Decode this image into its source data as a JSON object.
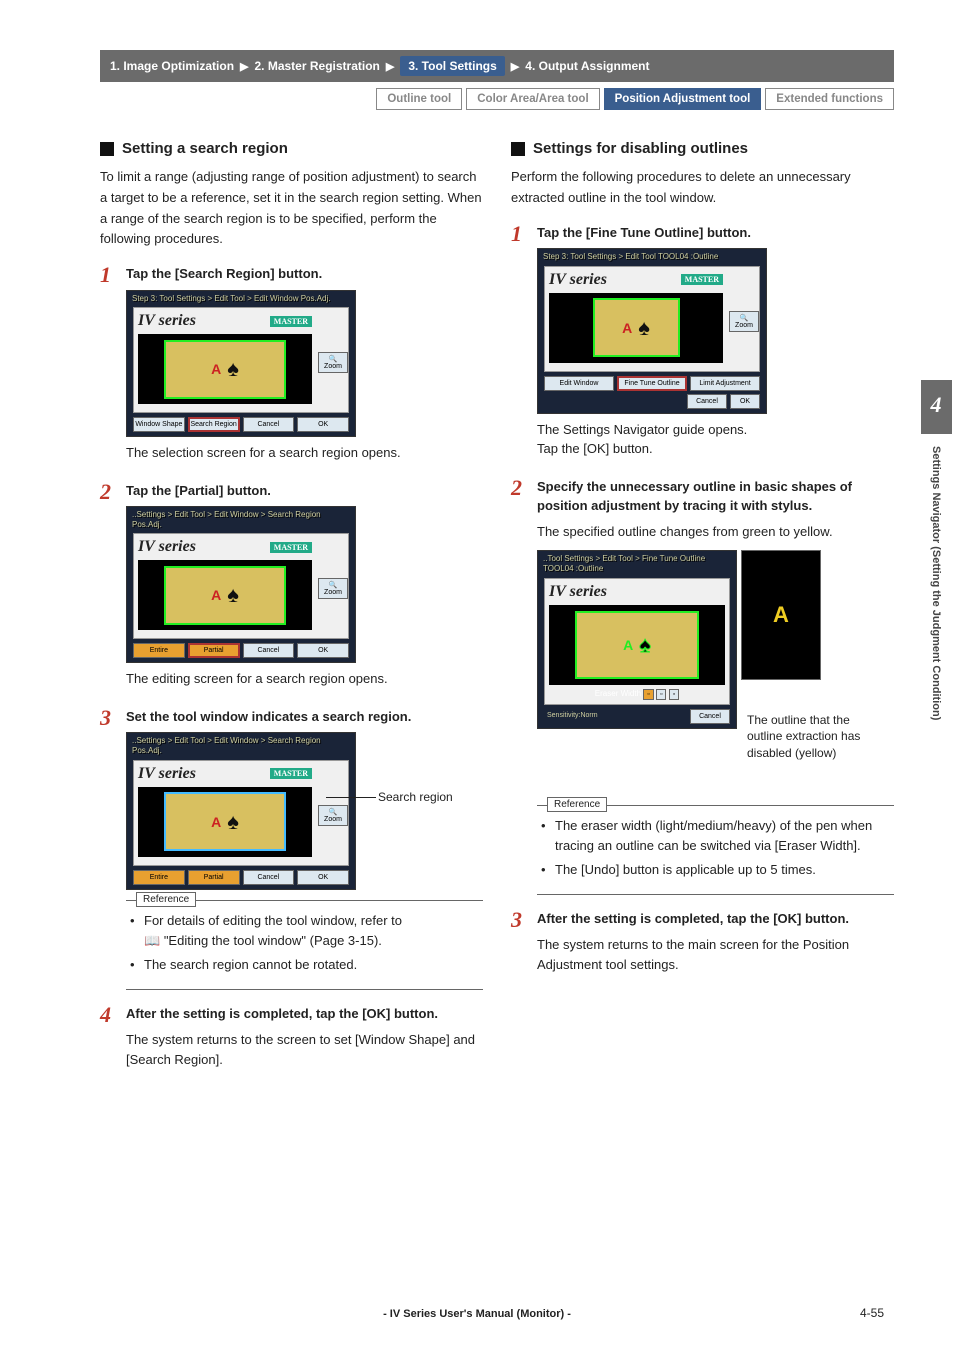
{
  "breadcrumb": {
    "items": [
      "1. Image Optimization",
      "2. Master Registration",
      "3. Tool Settings",
      "4. Output Assignment"
    ],
    "active_index": 2
  },
  "tabs": {
    "items": [
      "Outline tool",
      "Color Area/Area tool",
      "Position Adjustment tool",
      "Extended functions"
    ],
    "active_index": 2
  },
  "sidebar": {
    "chapter": "4",
    "title": "Settings Navigator (Setting the Judgment Condition)"
  },
  "left": {
    "heading": "Setting a search region",
    "intro": "To limit a range (adjusting range of position adjustment) to search a target to be a reference, set it in the search region setting. When a range of the search region is to be specified, perform the following procedures.",
    "steps": [
      {
        "num": "1",
        "title": "Tap the [Search Region] button.",
        "shot": {
          "crumbs": "Step 3: Tool Settings > Edit Tool > Edit Window Pos.Adj.",
          "buttons": [
            "Window Shape",
            "Search Region",
            "Cancel",
            "OK"
          ],
          "highlight": 1
        },
        "after": "The selection screen for a search region opens."
      },
      {
        "num": "2",
        "title": "Tap the [Partial] button.",
        "shot": {
          "crumbs": "..Settings > Edit Tool > Edit Window > Search Region Pos.Adj.",
          "buttons_orange": [
            "Entire",
            "Partial"
          ],
          "buttons": [
            "Cancel",
            "OK"
          ],
          "highlight_orange": 1
        },
        "after": "The editing screen for a search region opens."
      },
      {
        "num": "3",
        "title": "Set the tool window indicates a search region.",
        "shot": {
          "crumbs": "..Settings > Edit Tool > Edit Window > Search Region Pos.Adj.",
          "buttons_orange": [
            "Entire",
            "Partial"
          ],
          "buttons": [
            "Cancel",
            "OK"
          ]
        },
        "callout": "Search region",
        "reference": [
          "For details of editing the tool window, refer to",
          "\"Editing the tool window\" (Page 3-15).",
          "The search region cannot be rotated."
        ]
      },
      {
        "num": "4",
        "title": "After the setting is completed, tap the [OK] button.",
        "after": "The system returns to the screen to set [Window Shape] and [Search Region]."
      }
    ]
  },
  "right": {
    "heading": "Settings for disabling outlines",
    "intro": "Perform the following procedures to delete an unnecessary extracted outline in the tool window.",
    "steps": [
      {
        "num": "1",
        "title": "Tap the [Fine Tune Outline] button.",
        "shot": {
          "crumbs": "Step 3: Tool Settings > Edit Tool TOOL04 :Outline",
          "buttons": [
            "Edit Window",
            "Fine Tune Outline",
            "Limit Adjustment",
            "Cancel",
            "OK"
          ],
          "highlight": 1
        },
        "after": "The Settings Navigator guide opens.\nTap the [OK] button."
      },
      {
        "num": "2",
        "title": "Specify the unnecessary outline in basic shapes of position adjustment by tracing it with stylus.",
        "pre": "The specified outline changes from green to yellow.",
        "shot": {
          "crumbs": "..Tool Settings > Edit Tool > Fine Tune Outline TOOL04 :Outline",
          "bottom": "Eraser Width",
          "sens": "Sensitivity:Norm",
          "cancel": "Cancel"
        },
        "callout": "The outline that the outline extraction has disabled (yellow)",
        "reference": [
          "The eraser width (light/medium/heavy) of the pen when tracing an outline can be switched via [Eraser Width].",
          "The [Undo] button is applicable up to 5 times."
        ]
      },
      {
        "num": "3",
        "title": "After the setting is completed, tap the [OK] button.",
        "after": "The system returns to the main screen for the Position Adjustment tool settings."
      }
    ]
  },
  "ui": {
    "iv": "IV series",
    "master": "MASTER",
    "zoom": "🔍 Zoom",
    "reference_label": "Reference"
  },
  "footer": {
    "text": "- IV Series User's Manual (Monitor) -",
    "page": "4-55"
  }
}
